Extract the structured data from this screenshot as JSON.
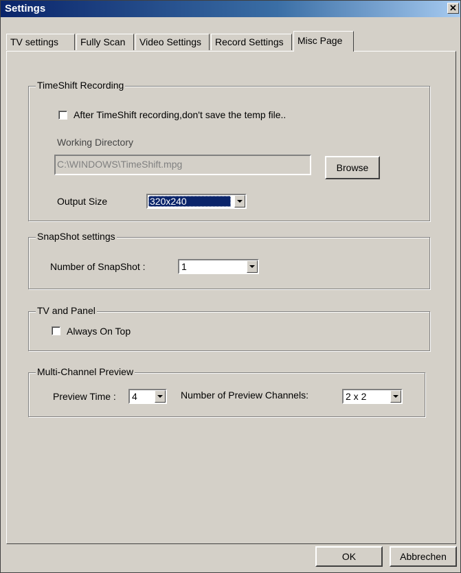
{
  "window": {
    "title": "Settings",
    "close_label": "✕"
  },
  "tabs": [
    {
      "label": "TV settings"
    },
    {
      "label": "Fully Scan"
    },
    {
      "label": "Video Settings"
    },
    {
      "label": "Record Settings"
    },
    {
      "label": "Misc Page",
      "active": true
    }
  ],
  "timeshift": {
    "legend": "TimeShift Recording",
    "checkbox_label": "After TimeShift recording,don't save the temp file..",
    "checkbox_checked": false,
    "working_dir_label": "Working Directory",
    "working_dir_value": "C:\\WINDOWS\\TimeShift.mpg",
    "browse_label": "Browse",
    "output_size_label": "Output Size",
    "output_size_value": "320x240"
  },
  "snapshot": {
    "legend": "SnapShot settings",
    "count_label": "Number of SnapShot :",
    "count_value": "1"
  },
  "tvpanel": {
    "legend": "TV and Panel",
    "always_on_top_label": "Always On Top",
    "always_on_top_checked": false
  },
  "multichannel": {
    "legend": "Multi-Channel Preview",
    "preview_time_label": "Preview Time :",
    "preview_time_value": "4",
    "channels_label": "Number of Preview Channels:",
    "channels_value": "2 x 2"
  },
  "footer": {
    "ok_label": "OK",
    "cancel_label": "Abbrechen"
  }
}
